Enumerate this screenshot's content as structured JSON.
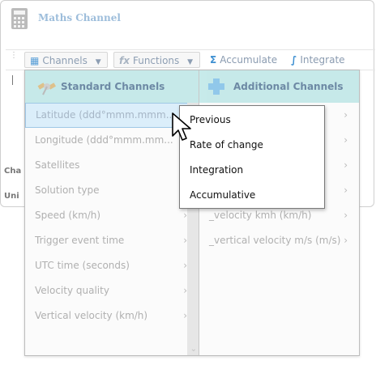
{
  "window": {
    "title": "Maths Channel",
    "side_labels": [
      "Cha",
      "Uni"
    ]
  },
  "toolbar": {
    "channels_label": "Channels",
    "functions_label": "Functions",
    "accumulate_label": "Accumulate",
    "integrate_label": "Integrate",
    "functions_icon": "fx",
    "accumulate_icon": "Σ",
    "integrate_icon": "∫"
  },
  "dropdown": {
    "standard_header": "Standard Channels",
    "additional_header": "Additional Channels",
    "standard_items": [
      {
        "label": "Latitude (ddd°mmm.mmm..."
      },
      {
        "label": "Longitude (ddd°mmm.mm..."
      },
      {
        "label": "Satellites"
      },
      {
        "label": "Solution type"
      },
      {
        "label": "Speed (km/h)"
      },
      {
        "label": "Trigger event time"
      },
      {
        "label": "UTC time (seconds)"
      },
      {
        "label": "Velocity quality"
      },
      {
        "label": "Vertical velocity (km/h)"
      }
    ],
    "additional_items": [
      {
        "label": ""
      },
      {
        "label": ""
      },
      {
        "label": ""
      },
      {
        "label": ""
      },
      {
        "label": "_velocity kmh (km/h)"
      },
      {
        "label": "_vertical velocity m/s (m/s)"
      }
    ]
  },
  "submenu": {
    "items": [
      {
        "label": "Previous"
      },
      {
        "label": "Rate of change"
      },
      {
        "label": "Integration"
      },
      {
        "label": "Accumulative"
      }
    ]
  },
  "colors": {
    "accent": "#3d8fd1",
    "header_bg": "#bde6e6",
    "selected_bg": "#dbeefa"
  }
}
